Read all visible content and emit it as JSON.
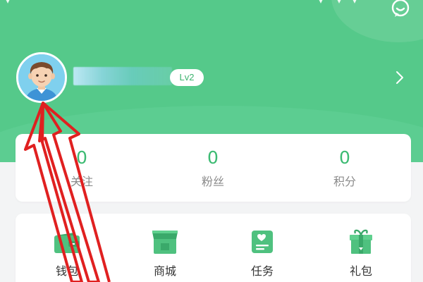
{
  "colors": {
    "header_bg": "#55c98a",
    "accent": "#3dbb73",
    "annotation_arrow": "#e02020"
  },
  "header": {
    "message_icon": "chat-bubble-icon",
    "level_badge": "Lv2",
    "profile_arrow_icon": "chevron-right-icon",
    "avatar_icon": "cartoon-avatar"
  },
  "stats": [
    {
      "value": "0",
      "label": "关注"
    },
    {
      "value": "0",
      "label": "粉丝"
    },
    {
      "value": "0",
      "label": "积分"
    }
  ],
  "menu": [
    {
      "label": "钱包",
      "icon": "wallet-icon"
    },
    {
      "label": "商城",
      "icon": "store-icon"
    },
    {
      "label": "任务",
      "icon": "task-icon"
    },
    {
      "label": "礼包",
      "icon": "gift-icon"
    }
  ],
  "annotation": {
    "icon": "red-arrow-annotation"
  }
}
